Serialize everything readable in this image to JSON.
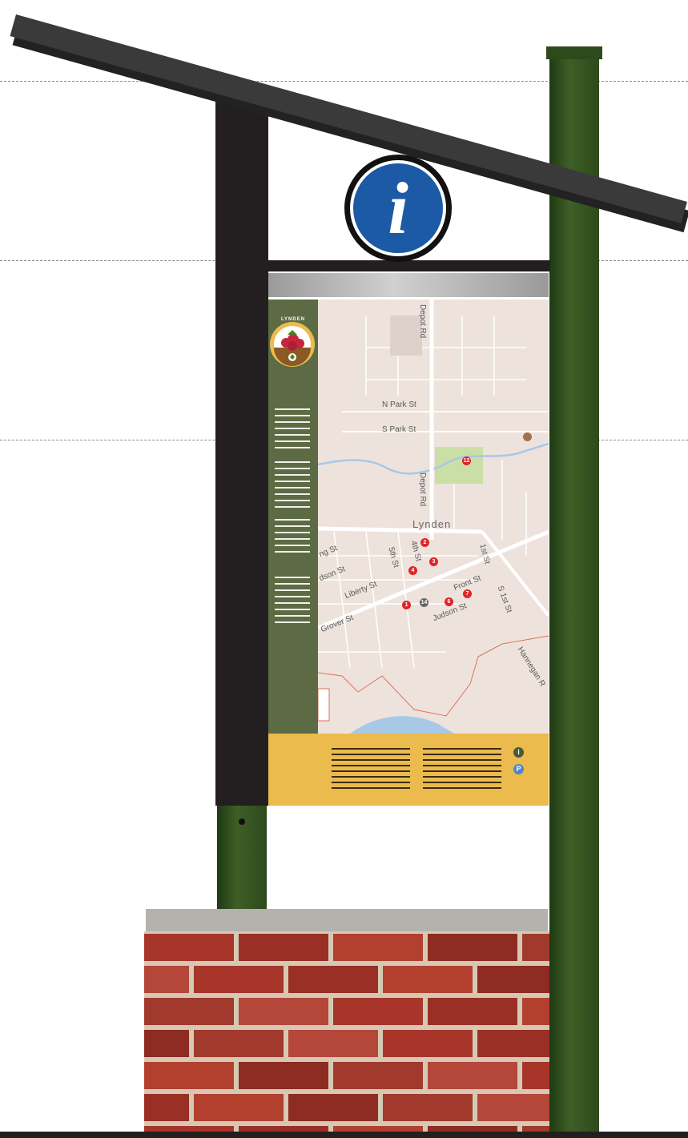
{
  "colors": {
    "roof": "#3a3a3a",
    "post_green": "#2d4a1c",
    "post_black": "#231f20",
    "info_blue": "#1c5aa6",
    "sidebar_green": "#5d6b45",
    "bottom_panel_yellow": "#ebbb4e",
    "marker_red": "#e2232a",
    "brick": "#a8352a"
  },
  "info_sign": {
    "icon": "info-icon",
    "glyph": "i"
  },
  "logo": {
    "text": "LYNDEN",
    "icon": "raspberry-logo-icon"
  },
  "map": {
    "town": "Lynden",
    "streets": [
      "Depot Rd",
      "N Park St",
      "S Park St",
      "Depot Rd",
      "5th St",
      "4th St",
      "1st St",
      "S 1st St",
      "Front St",
      "Judson St",
      "Liberty St",
      "dson St",
      "ng St",
      "Grover St",
      "Hannegan R"
    ],
    "markers": [
      "12",
      "2",
      "3",
      "4",
      "1",
      "14",
      "6",
      "7"
    ],
    "poi_icon": "school-icon"
  },
  "legend": [
    {
      "icon": "info-circle-icon",
      "glyph": "i",
      "color": "#4a5a35"
    },
    {
      "icon": "parking-icon",
      "glyph": "P",
      "color": "#4f86c6"
    }
  ]
}
